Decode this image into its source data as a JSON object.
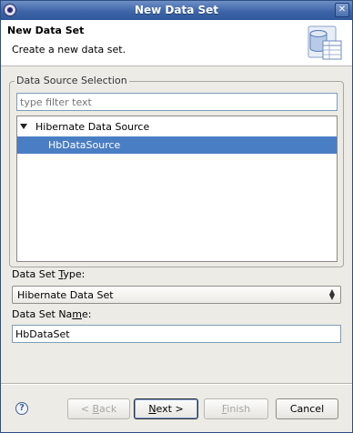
{
  "window": {
    "title": "New Data Set",
    "close_glyph": "✕"
  },
  "banner": {
    "heading": "New Data Set",
    "description": "Create a new data set.",
    "icon": "database-wizard-icon"
  },
  "data_source": {
    "group_label": "Data Source Selection",
    "filter_placeholder": "type filter text",
    "tree": {
      "parent": "Hibernate Data Source",
      "child": "HbDataSource",
      "selected": "HbDataSource"
    }
  },
  "dataset_type": {
    "label_pre": "Data Set ",
    "label_mnemonic": "T",
    "label_post": "ype:",
    "value": "Hibernate Data Set"
  },
  "dataset_name": {
    "label_pre": "Data Set Na",
    "label_mnemonic": "m",
    "label_post": "e:",
    "value": "HbDataSet"
  },
  "help": {
    "glyph": "?"
  },
  "buttons": {
    "back": {
      "pre": "< ",
      "mnemonic": "B",
      "post": "ack"
    },
    "next": {
      "pre": "",
      "mnemonic": "N",
      "post": "ext >"
    },
    "finish": {
      "pre": "",
      "mnemonic": "F",
      "post": "inish"
    },
    "cancel": "Cancel"
  }
}
